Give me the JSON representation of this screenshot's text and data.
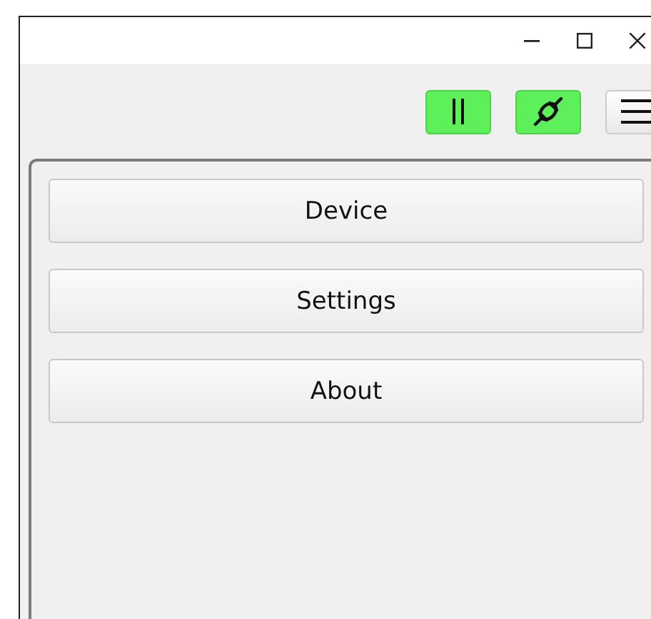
{
  "toolbar": {
    "buttons": [
      {
        "kind": "pause",
        "active": true
      },
      {
        "kind": "plug",
        "active": true
      },
      {
        "kind": "menu",
        "active": false
      }
    ]
  },
  "menu": [
    {
      "label": "Device"
    },
    {
      "label": "Settings"
    },
    {
      "label": "About"
    }
  ]
}
